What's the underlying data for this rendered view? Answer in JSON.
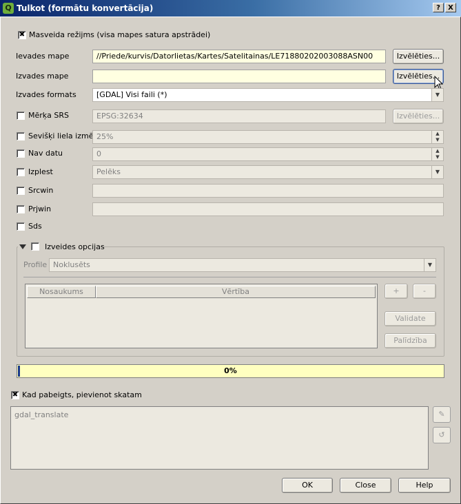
{
  "window": {
    "title": "Tulkot (formātu konvertācija)",
    "help_button": "?",
    "close_button": "X",
    "app_icon": "Q"
  },
  "batch_mode": {
    "checked": true,
    "label": "Masveida režijms (visa mapes satura apstrādei)"
  },
  "input_folder": {
    "label": "Ievades mape",
    "value": "//Priede/kurvis/Datorlietas/Kartes/Satelitainas/LE71880202003088ASN00",
    "browse": "Izvēlēties..."
  },
  "output_folder": {
    "label": "Izvades mape",
    "value": "",
    "browse": "Izvēlēties..."
  },
  "output_format": {
    "label": "Izvades formats",
    "value": "[GDAL] Visi faili (*)"
  },
  "target_srs": {
    "label": "Mērķa SRS",
    "value": "EPSG:32634",
    "browse": "Izvēlēties..."
  },
  "outsize": {
    "label": "Sevišķi liela izmēr",
    "value": "25%"
  },
  "nodata": {
    "label": "Nav datu",
    "value": "0"
  },
  "expand": {
    "label": "Izplest",
    "value": "Pelēks"
  },
  "srcwin": {
    "label": "Srcwin",
    "value": ""
  },
  "prjwin": {
    "label": "Prjwin",
    "value": ""
  },
  "sds": {
    "label": "Sds"
  },
  "creation_options": {
    "label": "Izveides opcijas",
    "profile_label": "Profile",
    "profile_value": "Noklusēts",
    "columns": [
      "Nosaukums",
      "Vērtība"
    ],
    "add_button": "+",
    "remove_button": "-",
    "validate_button": "Validate",
    "help_button": "Palīdzība"
  },
  "progress": {
    "value": 0,
    "text": "0%"
  },
  "load_into_canvas": {
    "checked": true,
    "label": "Kad pabeigts, pievienot skatam"
  },
  "command": {
    "text": "gdal_translate",
    "edit_icon": "✎",
    "reset_icon": "↺"
  },
  "buttons": {
    "ok": "OK",
    "close": "Close",
    "help": "Help"
  }
}
